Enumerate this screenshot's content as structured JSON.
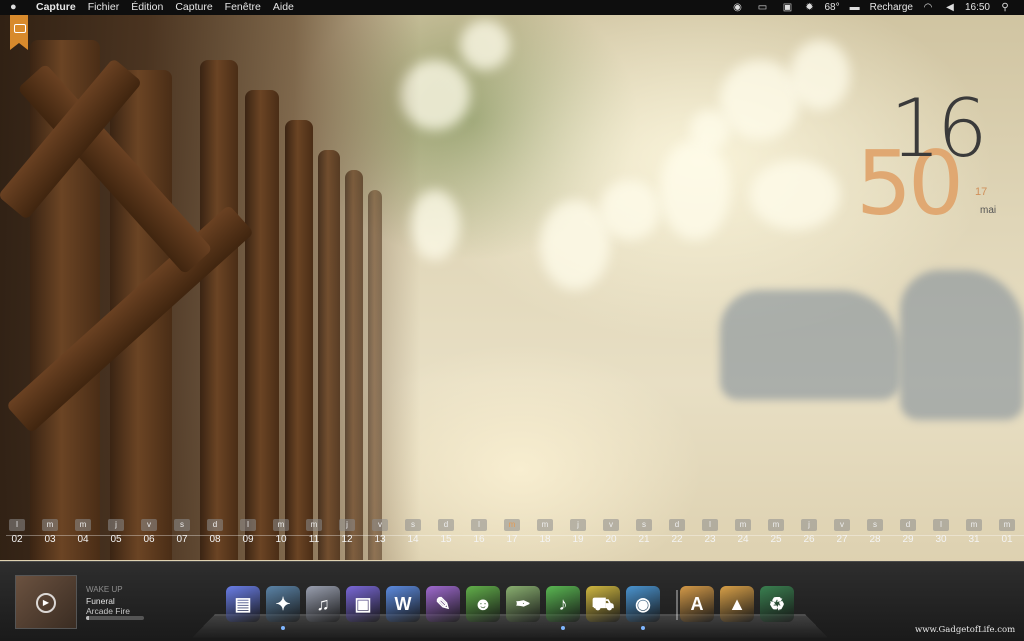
{
  "menubar": {
    "app": "Capture",
    "items": [
      "Fichier",
      "Édition",
      "Capture",
      "Fenêtre",
      "Aide"
    ],
    "right": {
      "icons": [
        "rss-icon",
        "keyboard-icon",
        "display-icon"
      ],
      "temperature": "68°",
      "battery_status": "Recharge",
      "time": "16:50",
      "status_icons": [
        "battery-icon",
        "wifi-icon",
        "volume-icon",
        "search-icon"
      ]
    }
  },
  "clock": {
    "hours": "16",
    "minutes": "50",
    "day": "17",
    "month": "mai"
  },
  "calendar": {
    "days": [
      {
        "dn": "l",
        "dd": "02"
      },
      {
        "dn": "m",
        "dd": "03"
      },
      {
        "dn": "m",
        "dd": "04"
      },
      {
        "dn": "j",
        "dd": "05"
      },
      {
        "dn": "v",
        "dd": "06"
      },
      {
        "dn": "s",
        "dd": "07"
      },
      {
        "dn": "d",
        "dd": "08"
      },
      {
        "dn": "l",
        "dd": "09"
      },
      {
        "dn": "m",
        "dd": "10"
      },
      {
        "dn": "m",
        "dd": "11"
      },
      {
        "dn": "j",
        "dd": "12"
      },
      {
        "dn": "v",
        "dd": "13"
      },
      {
        "dn": "s",
        "dd": "14"
      },
      {
        "dn": "d",
        "dd": "15"
      },
      {
        "dn": "l",
        "dd": "16"
      },
      {
        "dn": "m",
        "dd": "17",
        "today": true
      },
      {
        "dn": "m",
        "dd": "18"
      },
      {
        "dn": "j",
        "dd": "19"
      },
      {
        "dn": "v",
        "dd": "20"
      },
      {
        "dn": "s",
        "dd": "21"
      },
      {
        "dn": "d",
        "dd": "22"
      },
      {
        "dn": "l",
        "dd": "23"
      },
      {
        "dn": "m",
        "dd": "24"
      },
      {
        "dn": "m",
        "dd": "25"
      },
      {
        "dn": "j",
        "dd": "26"
      },
      {
        "dn": "v",
        "dd": "27"
      },
      {
        "dn": "s",
        "dd": "28"
      },
      {
        "dn": "d",
        "dd": "29"
      },
      {
        "dn": "l",
        "dd": "30"
      },
      {
        "dn": "m",
        "dd": "31"
      },
      {
        "dn": "m",
        "dd": "01"
      }
    ]
  },
  "now_playing": {
    "album": "WAKE UP",
    "song": "Funeral",
    "artist": "Arcade Fire",
    "progress": 0.05
  },
  "dock": {
    "icons": [
      {
        "name": "finder-icon",
        "glyph": "▤",
        "color": "#6a7ee8"
      },
      {
        "name": "safari-icon",
        "glyph": "✦",
        "color": "#5b84a8"
      },
      {
        "name": "itunes-icon",
        "glyph": "♫",
        "color": "#9aa0b0"
      },
      {
        "name": "photo-icon",
        "glyph": "▣",
        "color": "#7a68d8"
      },
      {
        "name": "word-icon",
        "glyph": "W",
        "color": "#5c8be0"
      },
      {
        "name": "feather-icon",
        "glyph": "✎",
        "color": "#a06ad0"
      },
      {
        "name": "android-icon",
        "glyph": "☻",
        "color": "#62b04a"
      },
      {
        "name": "quill-icon",
        "glyph": "✒",
        "color": "#8ab070"
      },
      {
        "name": "music-icon",
        "glyph": "♪",
        "color": "#5ab852"
      },
      {
        "name": "truck-icon",
        "glyph": "⛟",
        "color": "#d0b840"
      },
      {
        "name": "camera-icon",
        "glyph": "◉",
        "color": "#4a94d0"
      },
      {
        "name": "folder-a-icon",
        "glyph": "A",
        "color": "#d49a48"
      },
      {
        "name": "folder-b-icon",
        "glyph": "▲",
        "color": "#d8a048"
      },
      {
        "name": "trash-icon",
        "glyph": "♻",
        "color": "#3a8050"
      }
    ]
  },
  "watermark": "www.GadgetofLife.com"
}
